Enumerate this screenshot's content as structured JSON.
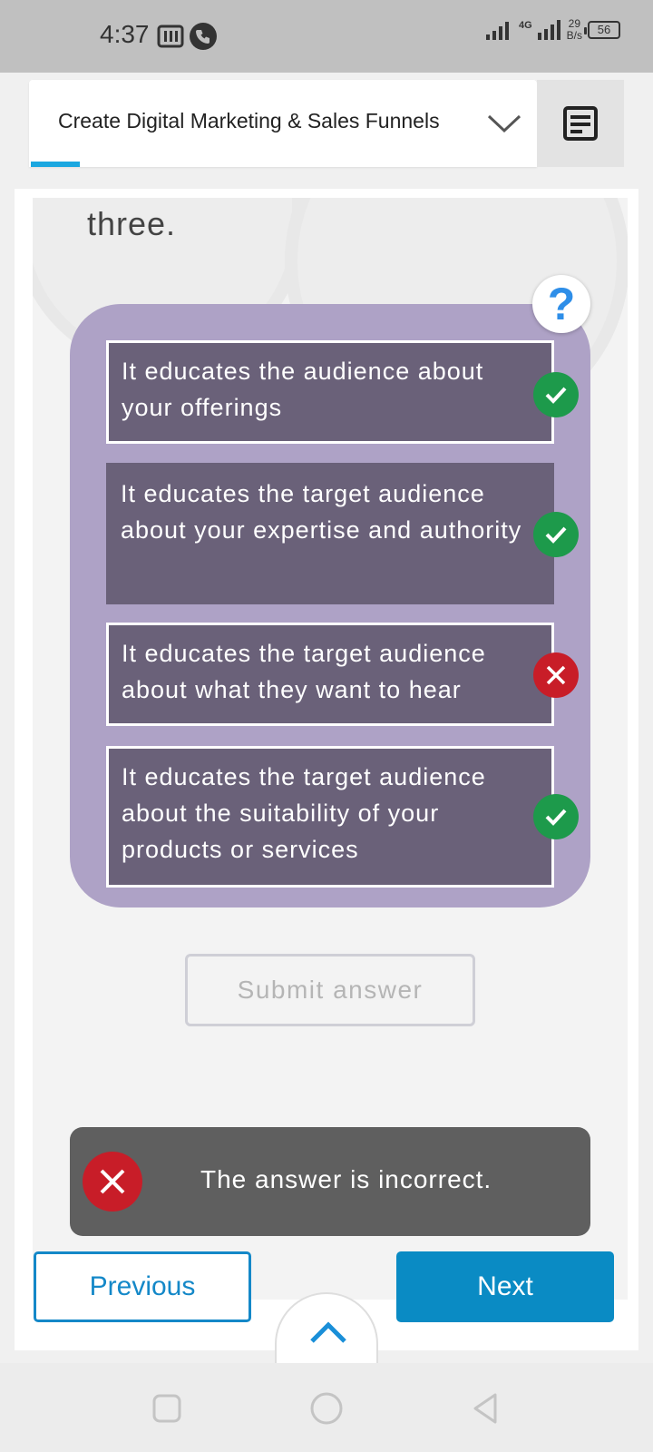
{
  "status_bar": {
    "time": "4:37",
    "network": "4G",
    "speed_value": "29",
    "speed_unit": "B/s",
    "battery": "56",
    "icons": [
      "pdf-app-icon",
      "phone-call-icon",
      "signal-icon",
      "battery-icon"
    ]
  },
  "header": {
    "course_title": "Create Digital Marketing & Sales Funnels",
    "dropdown_icon": "chevron-down-icon",
    "outline_icon": "outline-icon",
    "tab_accent": "#1aa7e0"
  },
  "question": {
    "tail_text": "three.",
    "help_icon": "help-question-icon",
    "help_glyph": "?",
    "options": [
      {
        "text": "It educates the audience about your offerings",
        "selected": true,
        "result": "correct"
      },
      {
        "text": "It educates the target audience about your expertise and authority",
        "selected": false,
        "result": "correct"
      },
      {
        "text": "It educates the target audience about what they want to hear",
        "selected": true,
        "result": "incorrect"
      },
      {
        "text": "It educates the target audience about the suitability of your products or services",
        "selected": true,
        "result": "correct"
      }
    ]
  },
  "submit_label": "Submit answer",
  "feedback": {
    "text": "The answer is incorrect.",
    "icon": "close-circle-icon"
  },
  "nav": {
    "previous_label": "Previous",
    "next_label": "Next",
    "expand_icon": "chevron-up-icon"
  },
  "colors": {
    "card": "#aea2c6",
    "option": "#6a6179",
    "correct": "#1d9a4b",
    "incorrect": "#c81d28",
    "primary": "#0a8bc4"
  }
}
